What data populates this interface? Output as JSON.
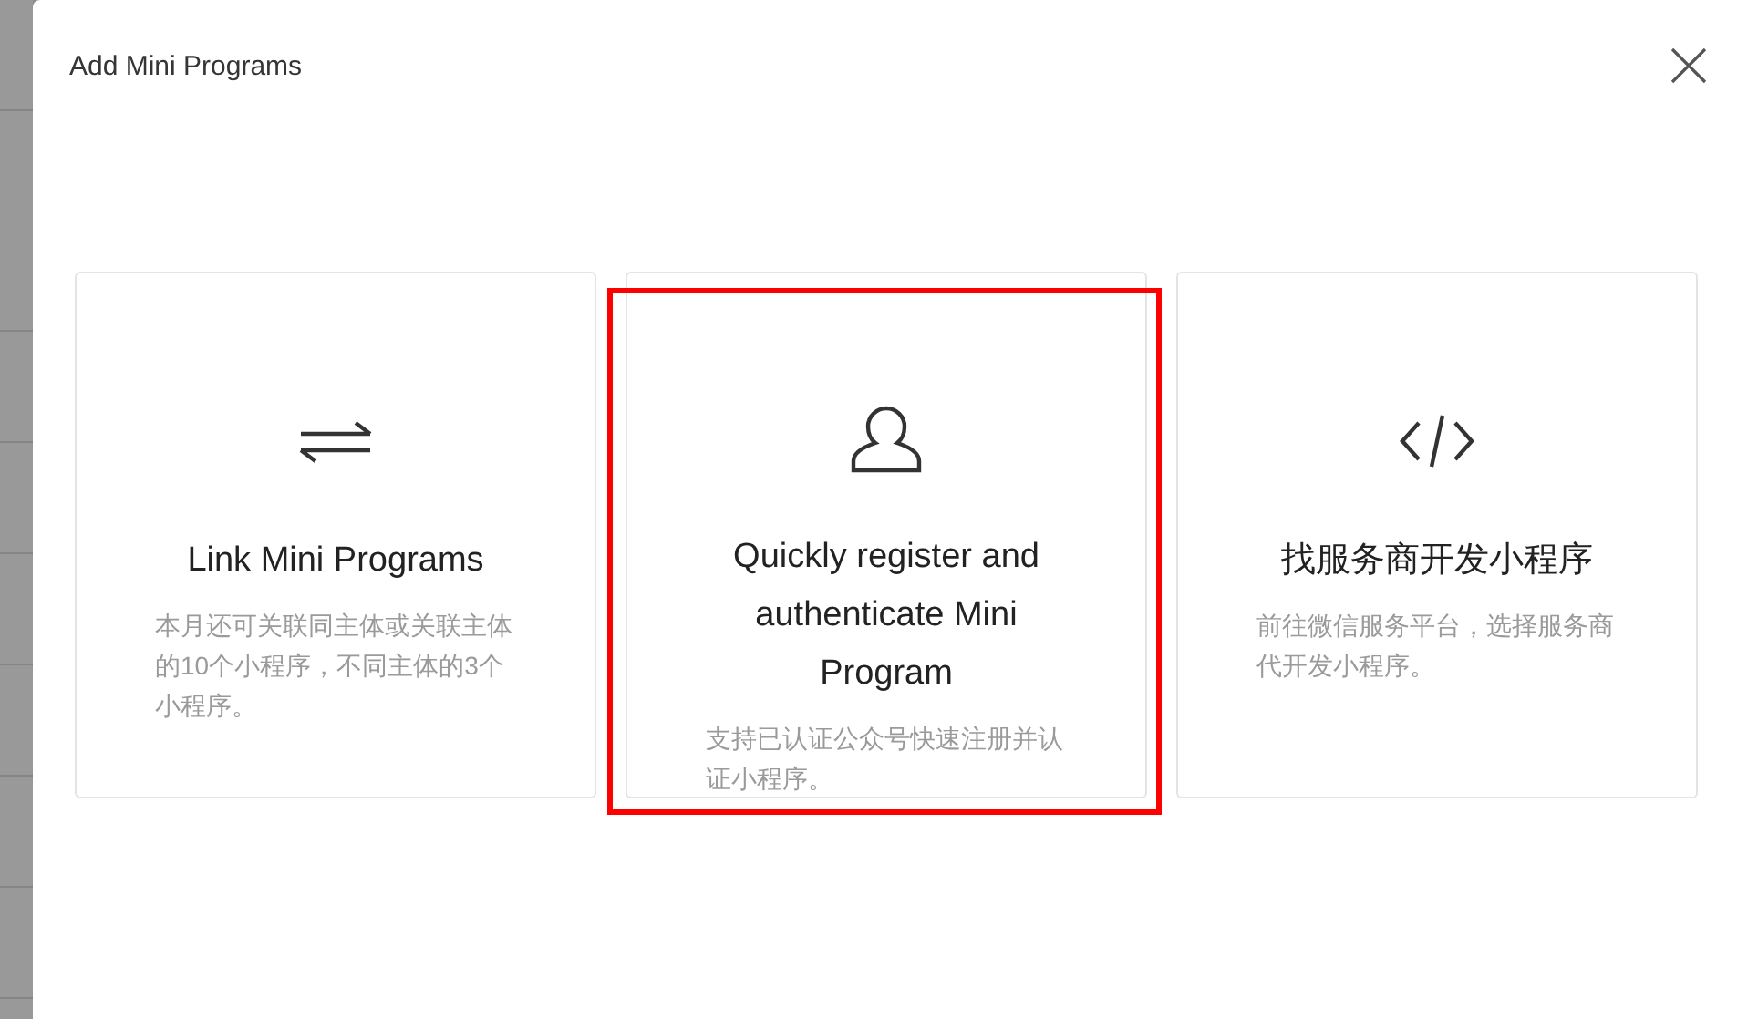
{
  "dialog": {
    "title": "Add Mini Programs"
  },
  "cards": [
    {
      "title": "Link Mini Programs",
      "description": "本月还可关联同主体或关联主体的10个小程序，不同主体的3个小程序。",
      "highlighted": false
    },
    {
      "title": "Quickly register and authenticate Mini Program",
      "description": "支持已认证公众号快速注册并认证小程序。",
      "highlighted": true
    },
    {
      "title": "找服务商开发小程序",
      "description": "前往微信服务平台，选择服务商代开发小程序。",
      "highlighted": false
    }
  ]
}
